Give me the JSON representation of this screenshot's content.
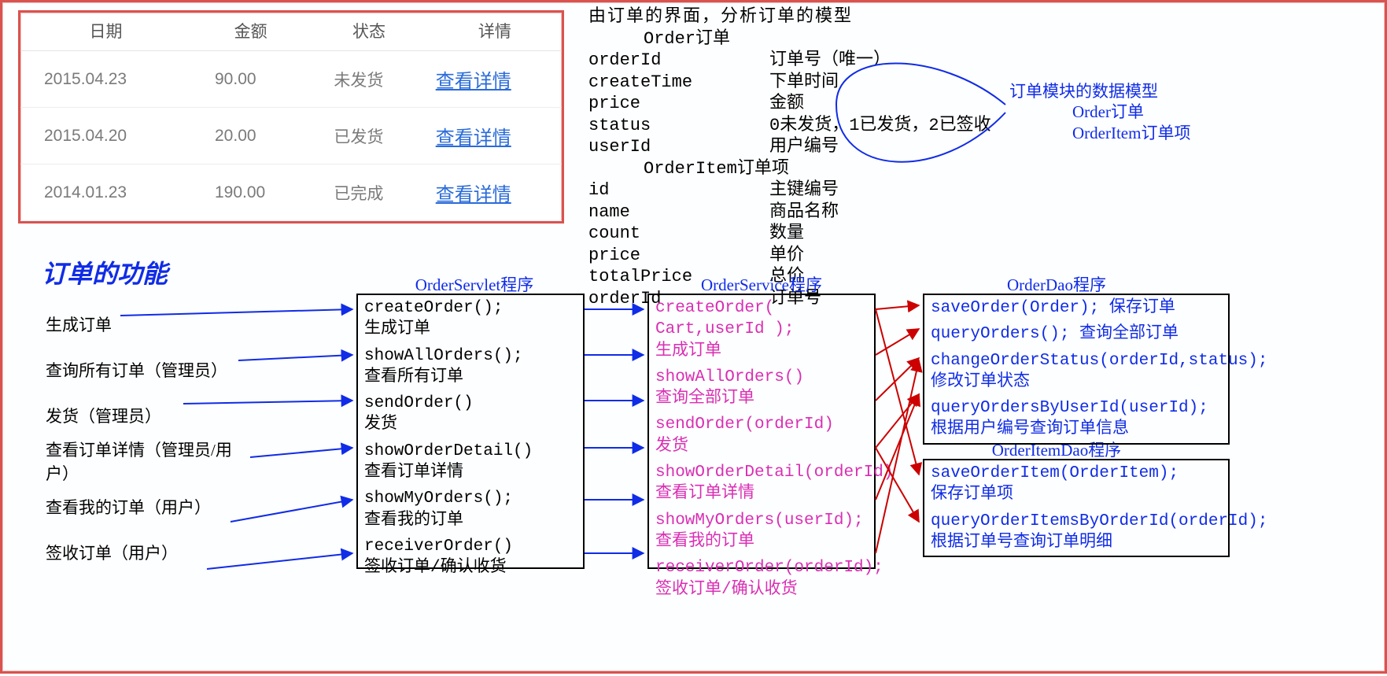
{
  "table": {
    "headers": [
      "日期",
      "金额",
      "状态",
      "详情"
    ],
    "rows": [
      {
        "date": "2015.04.23",
        "amount": "90.00",
        "status": "未发货",
        "detail": "查看详情"
      },
      {
        "date": "2015.04.20",
        "amount": "20.00",
        "status": "已发货",
        "detail": "查看详情"
      },
      {
        "date": "2014.01.23",
        "amount": "190.00",
        "status": "已完成",
        "detail": "查看详情"
      }
    ]
  },
  "analysis": {
    "title": "由订单的界面，分析订单的模型",
    "order_label": "Order订单",
    "order_fields": [
      {
        "k": "orderId",
        "v": "订单号（唯一）"
      },
      {
        "k": "createTime",
        "v": "下单时间"
      },
      {
        "k": "price",
        "v": "金额"
      },
      {
        "k": "status",
        "v": "0未发货，1已发货，2已签收"
      },
      {
        "k": "userId",
        "v": "用户编号"
      }
    ],
    "orderitem_label": "OrderItem订单项",
    "orderitem_fields": [
      {
        "k": "id",
        "v": "主键编号"
      },
      {
        "k": "name",
        "v": "商品名称"
      },
      {
        "k": "count",
        "v": "数量"
      },
      {
        "k": "price",
        "v": "单价"
      },
      {
        "k": "totalPrice",
        "v": "总价"
      },
      {
        "k": "orderId",
        "v": "订单号"
      }
    ]
  },
  "annotation": {
    "l1": "订单模块的数据模型",
    "l2": "Order订单",
    "l3": "OrderItem订单项"
  },
  "func_title": "订单的功能",
  "features": [
    "生成订单",
    "查询所有订单（管理员）",
    "发货（管理员）",
    "查看订单详情（管理员/用户）",
    "查看我的订单（用户）",
    "签收订单（用户）"
  ],
  "columns": {
    "servlet": {
      "title": "OrderServlet程序",
      "items": [
        {
          "a": "createOrder();",
          "b": "生成订单"
        },
        {
          "a": "showAllOrders();",
          "b": "查看所有订单"
        },
        {
          "a": "sendOrder()",
          "b": "发货"
        },
        {
          "a": "showOrderDetail()",
          "b": "查看订单详情"
        },
        {
          "a": "showMyOrders();",
          "b": "查看我的订单"
        },
        {
          "a": "receiverOrder()",
          "b": "签收订单/确认收货"
        }
      ]
    },
    "service": {
      "title": "OrderService程序",
      "items": [
        {
          "a": "createOrder( Cart,userId );",
          "b": "生成订单"
        },
        {
          "a": "showAllOrders()",
          "b": "查询全部订单"
        },
        {
          "a": "sendOrder(orderId)",
          "b": "发货"
        },
        {
          "a": "showOrderDetail(orderId)",
          "b": "查看订单详情"
        },
        {
          "a": "showMyOrders(userId);",
          "b": "查看我的订单"
        },
        {
          "a": "receiverOrder(orderId);",
          "b": "签收订单/确认收货"
        }
      ]
    },
    "dao": {
      "title": "OrderDao程序",
      "items": [
        {
          "a": "saveOrder(Order); 保存订单"
        },
        {
          "a": "queryOrders(); 查询全部订单"
        },
        {
          "a": "changeOrderStatus(orderId,status);",
          "b": "修改订单状态"
        },
        {
          "a": "queryOrdersByUserId(userId);",
          "b": "根据用户编号查询订单信息"
        }
      ]
    },
    "itemdao": {
      "title": "OrderItemDao程序",
      "items": [
        {
          "a": "saveOrderItem(OrderItem);",
          "b": "保存订单项"
        },
        {
          "a": "queryOrderItemsByOrderId(orderId);",
          "b": "根据订单号查询订单明细"
        }
      ]
    }
  }
}
